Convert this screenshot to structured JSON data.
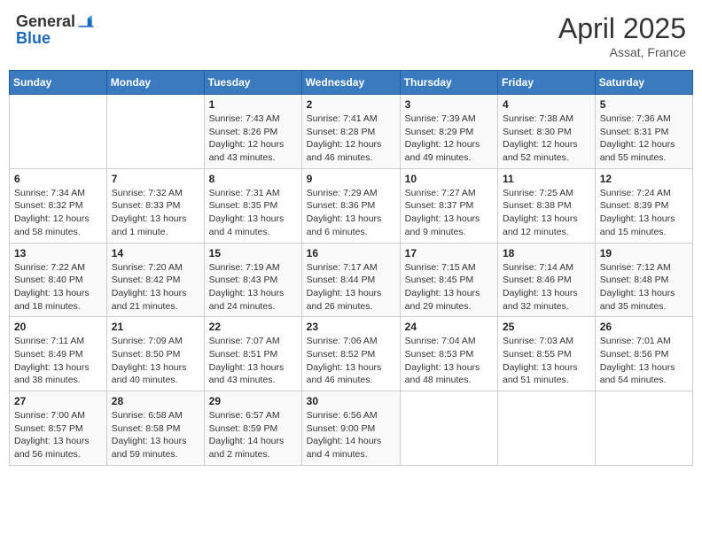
{
  "header": {
    "logo_general": "General",
    "logo_blue": "Blue",
    "title": "April 2025",
    "location": "Assat, France"
  },
  "days_of_week": [
    "Sunday",
    "Monday",
    "Tuesday",
    "Wednesday",
    "Thursday",
    "Friday",
    "Saturday"
  ],
  "weeks": [
    [
      {
        "day": "",
        "sunrise": "",
        "sunset": "",
        "daylight": ""
      },
      {
        "day": "",
        "sunrise": "",
        "sunset": "",
        "daylight": ""
      },
      {
        "day": "1",
        "sunrise": "Sunrise: 7:43 AM",
        "sunset": "Sunset: 8:26 PM",
        "daylight": "Daylight: 12 hours and 43 minutes."
      },
      {
        "day": "2",
        "sunrise": "Sunrise: 7:41 AM",
        "sunset": "Sunset: 8:28 PM",
        "daylight": "Daylight: 12 hours and 46 minutes."
      },
      {
        "day": "3",
        "sunrise": "Sunrise: 7:39 AM",
        "sunset": "Sunset: 8:29 PM",
        "daylight": "Daylight: 12 hours and 49 minutes."
      },
      {
        "day": "4",
        "sunrise": "Sunrise: 7:38 AM",
        "sunset": "Sunset: 8:30 PM",
        "daylight": "Daylight: 12 hours and 52 minutes."
      },
      {
        "day": "5",
        "sunrise": "Sunrise: 7:36 AM",
        "sunset": "Sunset: 8:31 PM",
        "daylight": "Daylight: 12 hours and 55 minutes."
      }
    ],
    [
      {
        "day": "6",
        "sunrise": "Sunrise: 7:34 AM",
        "sunset": "Sunset: 8:32 PM",
        "daylight": "Daylight: 12 hours and 58 minutes."
      },
      {
        "day": "7",
        "sunrise": "Sunrise: 7:32 AM",
        "sunset": "Sunset: 8:33 PM",
        "daylight": "Daylight: 13 hours and 1 minute."
      },
      {
        "day": "8",
        "sunrise": "Sunrise: 7:31 AM",
        "sunset": "Sunset: 8:35 PM",
        "daylight": "Daylight: 13 hours and 4 minutes."
      },
      {
        "day": "9",
        "sunrise": "Sunrise: 7:29 AM",
        "sunset": "Sunset: 8:36 PM",
        "daylight": "Daylight: 13 hours and 6 minutes."
      },
      {
        "day": "10",
        "sunrise": "Sunrise: 7:27 AM",
        "sunset": "Sunset: 8:37 PM",
        "daylight": "Daylight: 13 hours and 9 minutes."
      },
      {
        "day": "11",
        "sunrise": "Sunrise: 7:25 AM",
        "sunset": "Sunset: 8:38 PM",
        "daylight": "Daylight: 13 hours and 12 minutes."
      },
      {
        "day": "12",
        "sunrise": "Sunrise: 7:24 AM",
        "sunset": "Sunset: 8:39 PM",
        "daylight": "Daylight: 13 hours and 15 minutes."
      }
    ],
    [
      {
        "day": "13",
        "sunrise": "Sunrise: 7:22 AM",
        "sunset": "Sunset: 8:40 PM",
        "daylight": "Daylight: 13 hours and 18 minutes."
      },
      {
        "day": "14",
        "sunrise": "Sunrise: 7:20 AM",
        "sunset": "Sunset: 8:42 PM",
        "daylight": "Daylight: 13 hours and 21 minutes."
      },
      {
        "day": "15",
        "sunrise": "Sunrise: 7:19 AM",
        "sunset": "Sunset: 8:43 PM",
        "daylight": "Daylight: 13 hours and 24 minutes."
      },
      {
        "day": "16",
        "sunrise": "Sunrise: 7:17 AM",
        "sunset": "Sunset: 8:44 PM",
        "daylight": "Daylight: 13 hours and 26 minutes."
      },
      {
        "day": "17",
        "sunrise": "Sunrise: 7:15 AM",
        "sunset": "Sunset: 8:45 PM",
        "daylight": "Daylight: 13 hours and 29 minutes."
      },
      {
        "day": "18",
        "sunrise": "Sunrise: 7:14 AM",
        "sunset": "Sunset: 8:46 PM",
        "daylight": "Daylight: 13 hours and 32 minutes."
      },
      {
        "day": "19",
        "sunrise": "Sunrise: 7:12 AM",
        "sunset": "Sunset: 8:48 PM",
        "daylight": "Daylight: 13 hours and 35 minutes."
      }
    ],
    [
      {
        "day": "20",
        "sunrise": "Sunrise: 7:11 AM",
        "sunset": "Sunset: 8:49 PM",
        "daylight": "Daylight: 13 hours and 38 minutes."
      },
      {
        "day": "21",
        "sunrise": "Sunrise: 7:09 AM",
        "sunset": "Sunset: 8:50 PM",
        "daylight": "Daylight: 13 hours and 40 minutes."
      },
      {
        "day": "22",
        "sunrise": "Sunrise: 7:07 AM",
        "sunset": "Sunset: 8:51 PM",
        "daylight": "Daylight: 13 hours and 43 minutes."
      },
      {
        "day": "23",
        "sunrise": "Sunrise: 7:06 AM",
        "sunset": "Sunset: 8:52 PM",
        "daylight": "Daylight: 13 hours and 46 minutes."
      },
      {
        "day": "24",
        "sunrise": "Sunrise: 7:04 AM",
        "sunset": "Sunset: 8:53 PM",
        "daylight": "Daylight: 13 hours and 48 minutes."
      },
      {
        "day": "25",
        "sunrise": "Sunrise: 7:03 AM",
        "sunset": "Sunset: 8:55 PM",
        "daylight": "Daylight: 13 hours and 51 minutes."
      },
      {
        "day": "26",
        "sunrise": "Sunrise: 7:01 AM",
        "sunset": "Sunset: 8:56 PM",
        "daylight": "Daylight: 13 hours and 54 minutes."
      }
    ],
    [
      {
        "day": "27",
        "sunrise": "Sunrise: 7:00 AM",
        "sunset": "Sunset: 8:57 PM",
        "daylight": "Daylight: 13 hours and 56 minutes."
      },
      {
        "day": "28",
        "sunrise": "Sunrise: 6:58 AM",
        "sunset": "Sunset: 8:58 PM",
        "daylight": "Daylight: 13 hours and 59 minutes."
      },
      {
        "day": "29",
        "sunrise": "Sunrise: 6:57 AM",
        "sunset": "Sunset: 8:59 PM",
        "daylight": "Daylight: 14 hours and 2 minutes."
      },
      {
        "day": "30",
        "sunrise": "Sunrise: 6:56 AM",
        "sunset": "Sunset: 9:00 PM",
        "daylight": "Daylight: 14 hours and 4 minutes."
      },
      {
        "day": "",
        "sunrise": "",
        "sunset": "",
        "daylight": ""
      },
      {
        "day": "",
        "sunrise": "",
        "sunset": "",
        "daylight": ""
      },
      {
        "day": "",
        "sunrise": "",
        "sunset": "",
        "daylight": ""
      }
    ]
  ]
}
